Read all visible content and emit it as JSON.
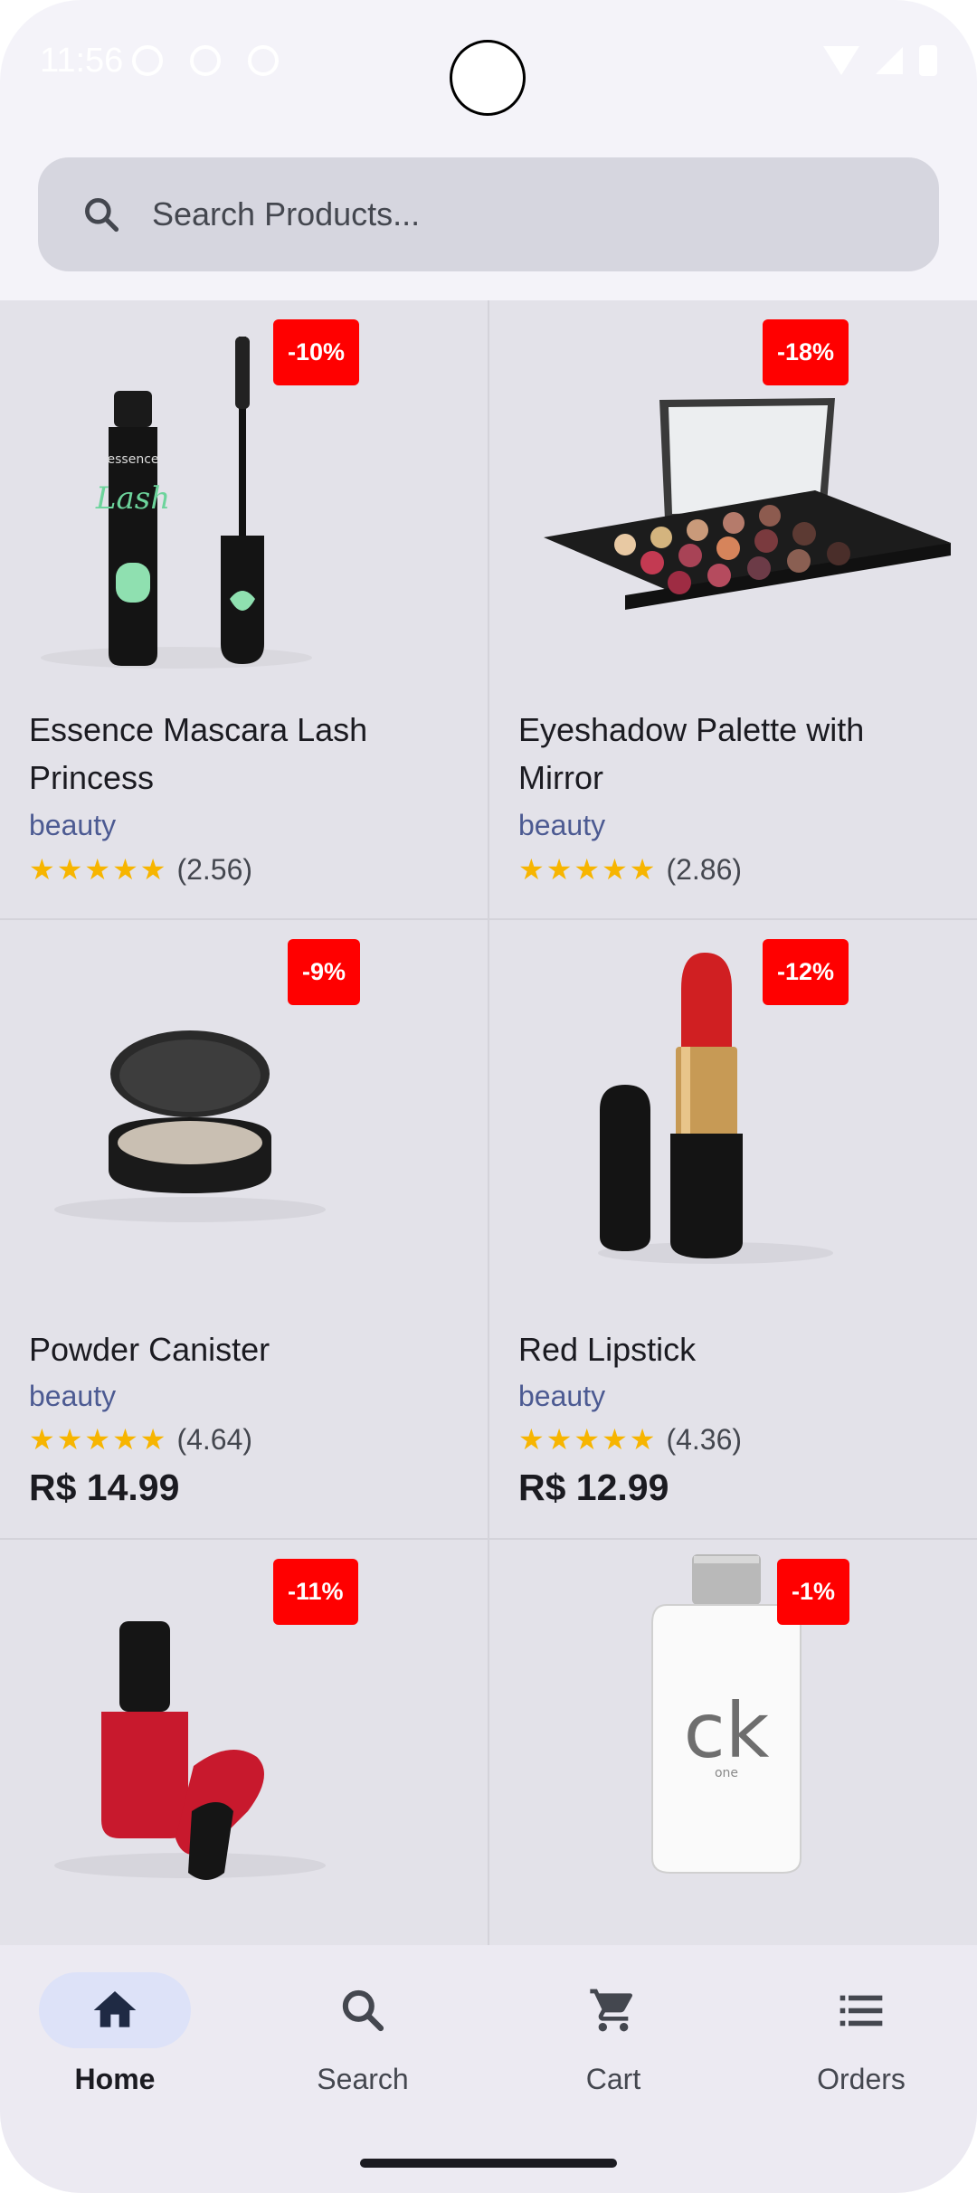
{
  "status_bar": {
    "time": "11:56"
  },
  "search": {
    "placeholder": "Search Products..."
  },
  "products": [
    {
      "title": "Essence Mascara Lash Princess",
      "category": "beauty",
      "rating": "(2.56)",
      "discount": "-10%",
      "price": ""
    },
    {
      "title": "Eyeshadow Palette with Mirror",
      "category": "beauty",
      "rating": "(2.86)",
      "discount": "-18%",
      "price": ""
    },
    {
      "title": "Powder Canister",
      "category": "beauty",
      "rating": "(4.64)",
      "discount": "-9%",
      "price": "R$ 14.99"
    },
    {
      "title": "Red Lipstick",
      "category": "beauty",
      "rating": "(4.36)",
      "discount": "-12%",
      "price": "R$ 12.99"
    },
    {
      "title": "",
      "category": "",
      "rating": "",
      "discount": "-11%",
      "price": ""
    },
    {
      "title": "",
      "category": "",
      "rating": "",
      "discount": "-1%",
      "price": ""
    }
  ],
  "stars": "★★★★★",
  "product_images": [
    "mascara-image",
    "eyeshadow-palette-image",
    "powder-canister-image",
    "red-lipstick-image",
    "nail-polish-image",
    "perfume-bottle-image"
  ],
  "nav": {
    "items": [
      {
        "label": "Home",
        "icon": "home-icon",
        "active": true
      },
      {
        "label": "Search",
        "icon": "search-icon",
        "active": false
      },
      {
        "label": "Cart",
        "icon": "cart-icon",
        "active": false
      },
      {
        "label": "Orders",
        "icon": "list-icon",
        "active": false
      }
    ]
  },
  "colors": {
    "badge": "#ff0000",
    "category": "#4c5a92",
    "star": "#f7b500",
    "active_pill": "#dde2f8"
  }
}
